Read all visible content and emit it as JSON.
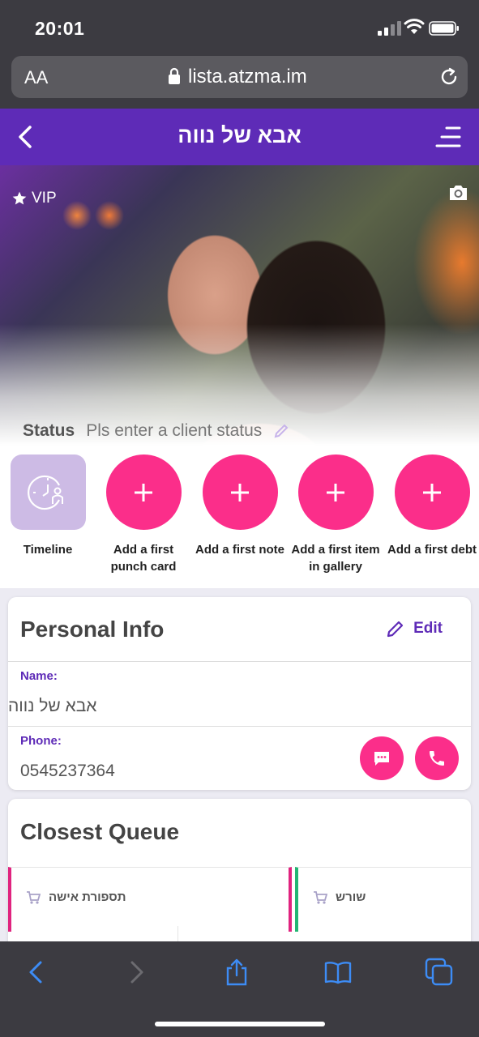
{
  "device": {
    "time": "20:01"
  },
  "browser": {
    "aa_label": "AA",
    "url": "lista.atzma.im"
  },
  "header": {
    "title": "אבא של נווה"
  },
  "hero": {
    "vip_label": "VIP",
    "status_label": "Status",
    "status_placeholder": "Pls enter a client status"
  },
  "actions": [
    {
      "label": "Timeline",
      "icon": "timeline-icon"
    },
    {
      "label": "Add a first\npunch card",
      "icon": "plus-icon"
    },
    {
      "label": "Add a first note",
      "icon": "plus-icon"
    },
    {
      "label": "Add a first item\nin gallery",
      "icon": "plus-icon"
    },
    {
      "label": "Add a first debt",
      "icon": "plus-icon"
    }
  ],
  "personal_info": {
    "title": "Personal Info",
    "edit_label": "Edit",
    "name_label": "Name:",
    "name_value": "אבא של נווה",
    "phone_label": "Phone:",
    "phone_value": "0545237364"
  },
  "closest_queue": {
    "title": "Closest Queue",
    "items": [
      {
        "label": "תספורת אישה",
        "accent": "#e0237f"
      },
      {
        "label": "שורש",
        "accent": "#22b573"
      }
    ]
  },
  "colors": {
    "primary": "#5e2bb7",
    "accent": "#fb2e8a",
    "timeline_bg": "#cdbbe5"
  }
}
